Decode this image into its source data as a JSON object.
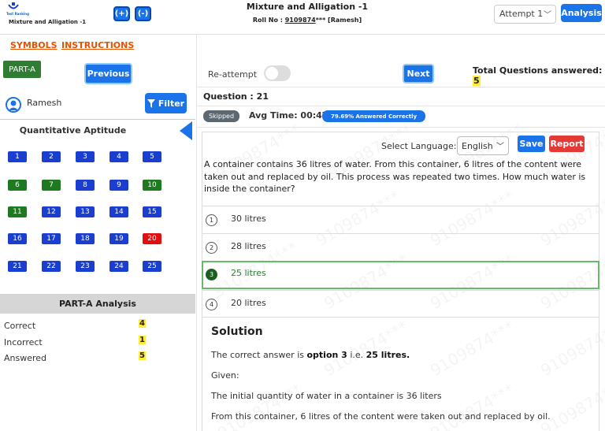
{
  "header": {
    "logo_text": "Test Ranking",
    "test_name_small": "Mixture and Alligation -1",
    "zoom_in_label": "(+)",
    "zoom_out_label": "(-)",
    "title": "Mixture and Alligation -1",
    "roll_prefix": "Roll No : ",
    "roll_number": "9109874",
    "roll_suffix": "*** [Ramesh]",
    "attempt_value": "Attempt 1",
    "analysis_label": "Analysis"
  },
  "links": {
    "symbols": "SYMBOLS",
    "instructions": "INSTRUCTIONS"
  },
  "left": {
    "part_badge": "PART-A",
    "previous_label": "Previous",
    "user_name": "Ramesh",
    "filter_label": "Filter",
    "section_title": "Quantitative Aptitude",
    "questions": [
      {
        "n": "1",
        "status": "blue"
      },
      {
        "n": "2",
        "status": "blue"
      },
      {
        "n": "3",
        "status": "blue"
      },
      {
        "n": "4",
        "status": "blue"
      },
      {
        "n": "5",
        "status": "blue"
      },
      {
        "n": "6",
        "status": "green"
      },
      {
        "n": "7",
        "status": "green"
      },
      {
        "n": "8",
        "status": "blue"
      },
      {
        "n": "9",
        "status": "blue"
      },
      {
        "n": "10",
        "status": "green"
      },
      {
        "n": "11",
        "status": "green"
      },
      {
        "n": "12",
        "status": "blue"
      },
      {
        "n": "13",
        "status": "blue"
      },
      {
        "n": "14",
        "status": "blue"
      },
      {
        "n": "15",
        "status": "blue"
      },
      {
        "n": "16",
        "status": "blue"
      },
      {
        "n": "17",
        "status": "blue"
      },
      {
        "n": "18",
        "status": "blue"
      },
      {
        "n": "19",
        "status": "blue"
      },
      {
        "n": "20",
        "status": "red"
      },
      {
        "n": "21",
        "status": "blue"
      },
      {
        "n": "22",
        "status": "blue"
      },
      {
        "n": "23",
        "status": "blue"
      },
      {
        "n": "24",
        "status": "blue"
      },
      {
        "n": "25",
        "status": "blue"
      }
    ],
    "analysis_title": "PART-A Analysis",
    "stats": [
      {
        "label": "Correct",
        "value": "4"
      },
      {
        "label": "Incorrect",
        "value": "1"
      },
      {
        "label": "Answered",
        "value": "5"
      }
    ]
  },
  "right": {
    "reattempt_label": "Re-attempt",
    "next_label": "Next",
    "total_answered_label": "Total Questions answered: ",
    "total_answered_value": "5",
    "question_number": "Question : 21",
    "skipped_badge": "Skipped",
    "avg_time": "Avg Time: 00:47",
    "answered_correctly_badge": "79.69% Answered Correctly",
    "select_language_label": "Select Language:",
    "language_value": "English",
    "save_label": "Save",
    "report_label": "Report",
    "question_text": "A container contains 36 litres of water. From this container, 6 litres of the content were taken out and replaced by oil. This process was repeated two times. How much water is inside the container?",
    "options": [
      {
        "num": "1",
        "text": "30 litres",
        "correct": false
      },
      {
        "num": "2",
        "text": "28 litres",
        "correct": false
      },
      {
        "num": "3",
        "text": "25 litres",
        "correct": true
      },
      {
        "num": "4",
        "text": "20 litres",
        "correct": false
      }
    ],
    "solution_title": "Solution",
    "solution_answer_prefix": "The correct answer is ",
    "solution_answer_option": "option 3",
    "solution_answer_mid": " i.e. ",
    "solution_answer_value": "25 litres.",
    "given_label": "Given:",
    "given_line1": "The initial quantity of water in a container is 36 liters",
    "given_line2": "From this container, 6 litres of the content were taken out and replaced by oil."
  },
  "watermark_text": "9109874***",
  "colors": {
    "primary": "#1a73e8",
    "answered_green": "#1e7a1e",
    "unanswered_blue": "#1a3fd0",
    "incorrect_red": "#e01010",
    "link_orange": "#e65100",
    "highlight_yellow": "#ffeb3b"
  }
}
